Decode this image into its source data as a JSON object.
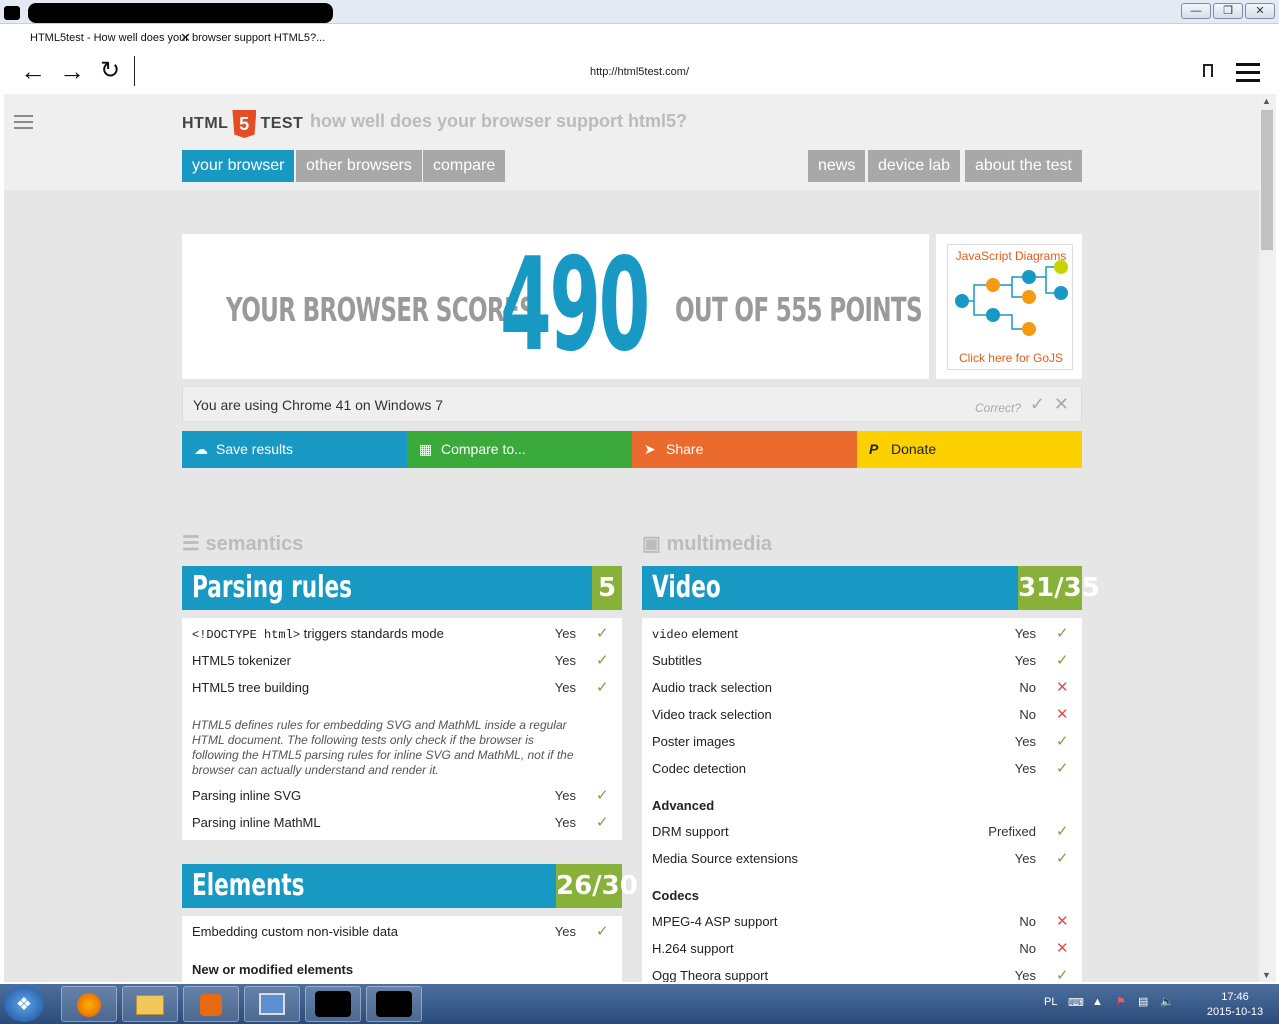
{
  "window": {
    "tab_title": "HTML5test - How well does your browser support HTML5?...",
    "url": "http://html5test.com/"
  },
  "site": {
    "logo_left": "HTML",
    "logo_num": "5",
    "logo_right": "TEST",
    "tagline": "how well does your browser support html5?",
    "nav_left": [
      "your browser",
      "other browsers",
      "compare"
    ],
    "nav_right": [
      "news",
      "device lab",
      "about the test"
    ]
  },
  "score": {
    "prefix": "YOUR BROWSER SCORES",
    "value": "490",
    "suffix": "OUT OF 555 POINTS"
  },
  "ad": {
    "title": "JavaScript Diagrams",
    "footer": "Click here for GoJS"
  },
  "using": {
    "text": "You are using Chrome 41 on Windows 7",
    "correct": "Correct?"
  },
  "actions": [
    {
      "label": "Save results",
      "color": "#1799c4"
    },
    {
      "label": "Compare to...",
      "color": "#3aab3a"
    },
    {
      "label": "Share",
      "color": "#eb6b2f"
    },
    {
      "label": "Donate",
      "color": "#fdd000"
    }
  ],
  "sections": {
    "left": "semantics",
    "right": "multimedia"
  },
  "parsing": {
    "title": "Parsing rules",
    "score": "5",
    "rows": [
      {
        "label": "<!DOCTYPE html>",
        "label_rest": " triggers standards mode",
        "value": "Yes"
      },
      {
        "label": "HTML5 tokenizer",
        "value": "Yes"
      },
      {
        "label": "HTML5 tree building",
        "value": "Yes"
      }
    ],
    "note": "HTML5 defines rules for embedding SVG and MathML inside a regular HTML document. The following tests only check if the browser is following the HTML5 parsing rules for inline SVG and MathML, not if the browser can actually understand and render it.",
    "rows2": [
      {
        "label": "Parsing inline SVG",
        "value": "Yes"
      },
      {
        "label": "Parsing inline MathML",
        "value": "Yes"
      }
    ]
  },
  "elements": {
    "title": "Elements",
    "score": "26/30",
    "rows": [
      {
        "label": "Embedding custom non-visible data",
        "value": "Yes"
      }
    ],
    "subhead": "New or modified elements"
  },
  "video": {
    "title": "Video",
    "score": "31/35",
    "rows": [
      {
        "label": "video",
        "label_rest": " element",
        "value": "Yes",
        "ok": true
      },
      {
        "label": "Subtitles",
        "value": "Yes",
        "ok": true
      },
      {
        "label": "Audio track selection",
        "value": "No",
        "ok": false
      },
      {
        "label": "Video track selection",
        "value": "No",
        "ok": false
      },
      {
        "label": "Poster images",
        "value": "Yes",
        "ok": true
      },
      {
        "label": "Codec detection",
        "value": "Yes",
        "ok": true
      }
    ],
    "advanced": "Advanced",
    "adv_rows": [
      {
        "label": "DRM support",
        "value": "Prefixed",
        "ok": true
      },
      {
        "label": "Media Source extensions",
        "value": "Yes",
        "ok": true
      }
    ],
    "codecs": "Codecs",
    "codec_rows": [
      {
        "label": "MPEG-4 ASP support",
        "value": "No",
        "ok": false
      },
      {
        "label": "H.264 support",
        "value": "No",
        "ok": false
      },
      {
        "label": "Ogg Theora support",
        "value": "Yes",
        "ok": true
      }
    ]
  },
  "taskbar": {
    "lang": "PL",
    "time": "17:46",
    "date": "2015-10-13"
  }
}
